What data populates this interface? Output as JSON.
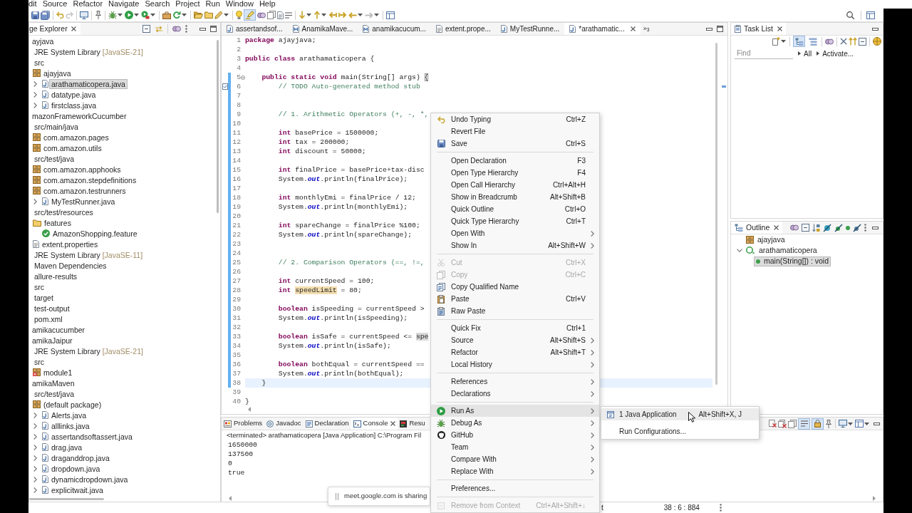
{
  "menu_bar": {
    "items": [
      "dit",
      "Source",
      "Refactor",
      "Navigate",
      "Search",
      "Project",
      "Run",
      "Window",
      "Help"
    ]
  },
  "main_toolbar": {
    "toggles": [
      {
        "pressed": true
      }
    ]
  },
  "package_explorer": {
    "title": "ge Explorer",
    "tree": [
      {
        "label": "ayjava",
        "selected": false,
        "children": [
          {
            "label": "JRE System Library",
            "decoration": "[JavaSE-21]",
            "selected": false
          },
          {
            "label": "src",
            "selected": false,
            "children": [
              {
                "label": "ajayjava",
                "kind": "package",
                "selected": false,
                "children": [
                  {
                    "label": "arathamaticopera.java",
                    "kind": "java",
                    "expanded": false,
                    "selected": true
                  },
                  {
                    "label": "datatype.java",
                    "kind": "java",
                    "expanded": false,
                    "selected": false
                  },
                  {
                    "label": "firstclass.java",
                    "kind": "java",
                    "expanded": false,
                    "selected": false
                  }
                ]
              }
            ]
          }
        ]
      },
      {
        "label": "mazonFrameworkCucumber",
        "selected": false,
        "children": [
          {
            "label": "src/main/java",
            "selected": false,
            "children": [
              {
                "label": "com.amazon.pages",
                "kind": "package",
                "selected": false
              },
              {
                "label": "com.amazon.utils",
                "kind": "package",
                "selected": false
              }
            ]
          },
          {
            "label": "src/test/java",
            "selected": false,
            "children": [
              {
                "label": "com.amazon.apphooks",
                "kind": "package",
                "selected": false
              },
              {
                "label": "com.amazon.stepdefinitions",
                "kind": "package",
                "selected": false
              },
              {
                "label": "com.amazon.testrunners",
                "kind": "package",
                "selected": false,
                "children": [
                  {
                    "label": "MyTestRunner.java",
                    "kind": "java",
                    "expanded": false,
                    "selected": false
                  }
                ]
              }
            ]
          },
          {
            "label": "src/test/resources",
            "selected": false,
            "children": [
              {
                "label": "features",
                "kind": "folder",
                "selected": false,
                "children": [
                  {
                    "label": "AmazonShopping.feature",
                    "kind": "feature",
                    "selected": false
                  }
                ]
              },
              {
                "label": "extent.properties",
                "kind": "file",
                "selected": false
              }
            ]
          },
          {
            "label": "JRE System Library",
            "decoration": "[JavaSE-11]",
            "selected": false
          },
          {
            "label": "Maven Dependencies",
            "selected": false
          },
          {
            "label": "allure-results",
            "selected": false
          },
          {
            "label": "src",
            "selected": false
          },
          {
            "label": "target",
            "selected": false
          },
          {
            "label": "test-output",
            "selected": false
          },
          {
            "label": "pom.xml",
            "selected": false
          }
        ]
      },
      {
        "label": "amikacucumber",
        "selected": false
      },
      {
        "label": "amikaJaipur",
        "selected": false,
        "children": [
          {
            "label": "JRE System Library",
            "decoration": "[JavaSE-21]",
            "selected": false
          },
          {
            "label": "src",
            "selected": false,
            "children": [
              {
                "label": "module1",
                "kind": "package_error",
                "selected": false
              }
            ]
          }
        ]
      },
      {
        "label": "amikaMaven",
        "selected": false,
        "children": [
          {
            "label": "src/test/java",
            "selected": false,
            "children": [
              {
                "label": "(default package)",
                "kind": "package",
                "selected": false,
                "children": [
                  {
                    "label": "Alerts.java",
                    "kind": "java",
                    "expanded": false,
                    "selected": false
                  },
                  {
                    "label": "alllinks.java",
                    "kind": "java",
                    "expanded": false,
                    "selected": false
                  },
                  {
                    "label": "assertandsoftassert.java",
                    "kind": "java",
                    "expanded": false,
                    "selected": false
                  },
                  {
                    "label": "drag.java",
                    "kind": "java",
                    "expanded": false,
                    "selected": false
                  },
                  {
                    "label": "draganddrop.java",
                    "kind": "java",
                    "expanded": false,
                    "selected": false
                  },
                  {
                    "label": "dropdown.java",
                    "kind": "java",
                    "expanded": false,
                    "selected": false
                  },
                  {
                    "label": "dynamicdropdown.java",
                    "kind": "java",
                    "expanded": false,
                    "selected": false
                  },
                  {
                    "label": "explicitwait.java",
                    "kind": "java",
                    "expanded": false,
                    "selected": false
                  }
                ]
              }
            ]
          }
        ]
      }
    ]
  },
  "editor": {
    "tabs": [
      {
        "label": "assertandsof...",
        "kind": "java",
        "selected": false
      },
      {
        "label": "AnamikaMave...",
        "kind": "maven",
        "selected": false
      },
      {
        "label": "anamikacucum...",
        "kind": "maven",
        "selected": false
      },
      {
        "label": "extent.prope...",
        "kind": "properties",
        "selected": false
      },
      {
        "label": "MyTestRunne...",
        "kind": "java",
        "selected": false
      },
      {
        "label": "*arathamatic...",
        "kind": "java",
        "selected": true
      }
    ],
    "overflow": "»$_{3}$",
    "lines": [
      {
        "number": "1",
        "segments": [
          {
            "kind": "keyword",
            "text": "package"
          },
          {
            "kind": "text",
            "text": " ajayjava;"
          }
        ]
      },
      {
        "number": "2"
      },
      {
        "number": "3",
        "segments": [
          {
            "kind": "keyword",
            "text": "public class"
          },
          {
            "kind": "text",
            "text": " arathamaticopera {"
          }
        ],
        "children": [
          {
            "number": "4"
          },
          {
            "number": "5",
            "in_range": true,
            "expanded": true,
            "segments": [
              {
                "kind": "keyword",
                "text": "public static void"
              },
              {
                "kind": "text",
                "text": " main(String[] args) "
              },
              {
                "kind": "bracket_match",
                "text": "{"
              }
            ],
            "children": [
              {
                "number": "6",
                "in_range": true,
                "task": true,
                "segments": [
                  {
                    "kind": "comment",
                    "text": "// TODO Auto-generated method stub"
                  }
                ]
              },
              {
                "number": "7",
                "in_range": true
              },
              {
                "number": "8",
                "in_range": true
              },
              {
                "number": "9",
                "in_range": true,
                "segments": [
                  {
                    "kind": "comment",
                    "text": "// 1. Arithmetic Operators (+, -, *,"
                  }
                ]
              },
              {
                "number": "10",
                "in_range": true
              },
              {
                "number": "11",
                "in_range": true,
                "segments": [
                  {
                    "kind": "keyword",
                    "text": "int"
                  },
                  {
                    "kind": "text",
                    "text": " basePrice = 1500000;"
                  }
                ]
              },
              {
                "number": "12",
                "in_range": true,
                "segments": [
                  {
                    "kind": "keyword",
                    "text": "int"
                  },
                  {
                    "kind": "text",
                    "text": " tax = 200000;"
                  }
                ]
              },
              {
                "number": "13",
                "in_range": true,
                "segments": [
                  {
                    "kind": "keyword",
                    "text": "int"
                  },
                  {
                    "kind": "text",
                    "text": " discount = 50000;"
                  }
                ]
              },
              {
                "number": "14",
                "in_range": true
              },
              {
                "number": "15",
                "in_range": true,
                "segments": [
                  {
                    "kind": "keyword",
                    "text": "int"
                  },
                  {
                    "kind": "text",
                    "text": " finalPrice = basePrice+tax-disc"
                  }
                ]
              },
              {
                "number": "16",
                "in_range": true,
                "segments": [
                  {
                    "kind": "text",
                    "text": "System."
                  },
                  {
                    "kind": "field",
                    "text": "out"
                  },
                  {
                    "kind": "text",
                    "text": ".println(finalPrice);"
                  }
                ]
              },
              {
                "number": "17",
                "in_range": true
              },
              {
                "number": "18",
                "in_range": true,
                "segments": [
                  {
                    "kind": "keyword",
                    "text": "int"
                  },
                  {
                    "kind": "text",
                    "text": " monthlyEmi = finalPrice / 12;"
                  }
                ]
              },
              {
                "number": "19",
                "in_range": true,
                "segments": [
                  {
                    "kind": "text",
                    "text": "System."
                  },
                  {
                    "kind": "field",
                    "text": "out"
                  },
                  {
                    "kind": "text",
                    "text": ".println(monthlyEmi);"
                  }
                ]
              },
              {
                "number": "20",
                "in_range": true
              },
              {
                "number": "21",
                "in_range": true,
                "segments": [
                  {
                    "kind": "keyword",
                    "text": "int"
                  },
                  {
                    "kind": "text",
                    "text": " spareChange = finalPrice %100;"
                  }
                ]
              },
              {
                "number": "22",
                "in_range": true,
                "segments": [
                  {
                    "kind": "text",
                    "text": "System."
                  },
                  {
                    "kind": "field",
                    "text": "out"
                  },
                  {
                    "kind": "text",
                    "text": ".println(spareChange);"
                  }
                ]
              },
              {
                "number": "23",
                "in_range": true
              },
              {
                "number": "24",
                "in_range": true
              },
              {
                "number": "25",
                "in_range": true,
                "segments": [
                  {
                    "kind": "comment",
                    "text": "// 2. Comparison Operators (==, !=,"
                  }
                ]
              },
              {
                "number": "26",
                "in_range": true
              },
              {
                "number": "27",
                "in_range": true,
                "segments": [
                  {
                    "kind": "keyword",
                    "text": "int"
                  },
                  {
                    "kind": "text",
                    "text": " currentSpeed = 100;"
                  }
                ]
              },
              {
                "number": "28",
                "in_range": true,
                "segments": [
                  {
                    "kind": "keyword",
                    "text": "int "
                  },
                  {
                    "kind": "write_occurrence",
                    "text": "speedLimit"
                  },
                  {
                    "kind": "text",
                    "text": " = 80;"
                  }
                ]
              },
              {
                "number": "29",
                "in_range": true
              },
              {
                "number": "30",
                "in_range": true,
                "segments": [
                  {
                    "kind": "keyword",
                    "text": "boolean"
                  },
                  {
                    "kind": "text",
                    "text": " isSpeeding = currentSpeed >"
                  }
                ]
              },
              {
                "number": "31",
                "in_range": true,
                "segments": [
                  {
                    "kind": "text",
                    "text": "System."
                  },
                  {
                    "kind": "field",
                    "text": "out"
                  },
                  {
                    "kind": "text",
                    "text": ".println(isSpeeding);"
                  }
                ]
              },
              {
                "number": "32",
                "in_range": true
              },
              {
                "number": "33",
                "in_range": true,
                "segments": [
                  {
                    "kind": "keyword",
                    "text": "boolean"
                  },
                  {
                    "kind": "text",
                    "text": " isSafe = currentSpeed <= "
                  },
                  {
                    "kind": "read_occurrence",
                    "text": "spe"
                  }
                ]
              },
              {
                "number": "34",
                "in_range": true,
                "segments": [
                  {
                    "kind": "text",
                    "text": "System."
                  },
                  {
                    "kind": "field",
                    "text": "out"
                  },
                  {
                    "kind": "text",
                    "text": ".println(isSafe);"
                  }
                ]
              },
              {
                "number": "35",
                "in_range": true
              },
              {
                "number": "36",
                "in_range": true,
                "segments": [
                  {
                    "kind": "keyword",
                    "text": "boolean"
                  },
                  {
                    "kind": "text",
                    "text": " bothEqual = currentSpeed =="
                  }
                ]
              },
              {
                "number": "37",
                "in_range": true,
                "segments": [
                  {
                    "kind": "text",
                    "text": "System."
                  },
                  {
                    "kind": "field",
                    "text": "out"
                  },
                  {
                    "kind": "text",
                    "text": ".println(bothEqual);"
                  }
                ]
              }
            ]
          },
          {
            "number": "38",
            "in_range": true,
            "current": true,
            "segments": [
              {
                "kind": "text",
                "text": "}"
              }
            ]
          },
          {
            "number": "39"
          }
        ]
      },
      {
        "number": "40",
        "segments": [
          {
            "kind": "text",
            "text": "}"
          }
        ]
      }
    ]
  },
  "task_list": {
    "title": "Task List",
    "toggles": [
      {
        "pressed": true
      },
      {
        "pressed": false
      }
    ],
    "find": {
      "placeholder": "Find"
    },
    "filters": [
      "All",
      "Activate..."
    ]
  },
  "outline": {
    "title": "Outline",
    "tree": [
      {
        "label": "ajayjava",
        "kind": "package",
        "selected": false
      },
      {
        "label": "arathamaticopera",
        "kind": "class",
        "expanded": true,
        "selected": false,
        "children": [
          {
            "label": "main(String[]) : void",
            "kind": "method",
            "selected": true
          }
        ]
      }
    ]
  },
  "console": {
    "tabs": [
      {
        "label": "Problems",
        "kind": "problems",
        "selected": false
      },
      {
        "label": "Javadoc",
        "kind": "javadoc",
        "selected": false
      },
      {
        "label": "Declaration",
        "kind": "declaration",
        "selected": false
      },
      {
        "label": "Console",
        "kind": "console",
        "selected": true
      },
      {
        "label": "Resu",
        "kind": "results",
        "selected": false
      }
    ],
    "toggles": [
      {
        "pressed": true
      },
      {
        "pressed": true
      }
    ],
    "header": "<terminated> arathamaticopera [Java Application] C:\\Program Fil",
    "output": [
      "1650000",
      "137500",
      "0",
      "true"
    ]
  },
  "status_bar": {
    "field_1": "t",
    "position": "38 : 6 : 884"
  },
  "share_notice": {
    "text": "meet.google.com is sharing"
  },
  "context_menu": {
    "groups": [
      [
        {
          "label": "Undo Typing",
          "shortcut": "Ctrl+Z",
          "kind": "undo",
          "submenu": false,
          "disabled": false,
          "selected": false
        },
        {
          "label": "Revert File",
          "submenu": false,
          "disabled": false,
          "selected": false
        },
        {
          "label": "Save",
          "shortcut": "Ctrl+S",
          "kind": "save",
          "submenu": false,
          "disabled": false,
          "selected": false
        }
      ],
      [
        {
          "label": "Open Declaration",
          "shortcut": "F3",
          "submenu": false,
          "disabled": false,
          "selected": false
        },
        {
          "label": "Open Type Hierarchy",
          "shortcut": "F4",
          "submenu": false,
          "disabled": false,
          "selected": false
        },
        {
          "label": "Open Call Hierarchy",
          "shortcut": "Ctrl+Alt+H",
          "submenu": false,
          "disabled": false,
          "selected": false
        },
        {
          "label": "Show in Breadcrumb",
          "shortcut": "Alt+Shift+B",
          "submenu": false,
          "disabled": false,
          "selected": false
        },
        {
          "label": "Quick Outline",
          "shortcut": "Ctrl+O",
          "submenu": false,
          "disabled": false,
          "selected": false
        },
        {
          "label": "Quick Type Hierarchy",
          "shortcut": "Ctrl+T",
          "submenu": false,
          "disabled": false,
          "selected": false
        },
        {
          "label": "Open With",
          "submenu": true,
          "disabled": false,
          "selected": false
        },
        {
          "label": "Show In",
          "shortcut": "Alt+Shift+W",
          "submenu": true,
          "disabled": false,
          "selected": false
        }
      ],
      [
        {
          "label": "Cut",
          "shortcut": "Ctrl+X",
          "kind": "cut",
          "submenu": false,
          "disabled": true,
          "selected": false
        },
        {
          "label": "Copy",
          "shortcut": "Ctrl+C",
          "kind": "copy",
          "submenu": false,
          "disabled": true,
          "selected": false
        },
        {
          "label": "Copy Qualified Name",
          "kind": "copy_name",
          "submenu": false,
          "disabled": false,
          "selected": false
        },
        {
          "label": "Paste",
          "shortcut": "Ctrl+V",
          "kind": "paste",
          "submenu": false,
          "disabled": false,
          "selected": false
        },
        {
          "label": "Raw Paste",
          "kind": "raw_paste",
          "submenu": false,
          "disabled": false,
          "selected": false
        }
      ],
      [
        {
          "label": "Quick Fix",
          "shortcut": "Ctrl+1",
          "submenu": false,
          "disabled": false,
          "selected": false
        },
        {
          "label": "Source",
          "shortcut": "Alt+Shift+S",
          "submenu": true,
          "disabled": false,
          "selected": false
        },
        {
          "label": "Refactor",
          "shortcut": "Alt+Shift+T",
          "submenu": true,
          "disabled": false,
          "selected": false
        },
        {
          "label": "Local History",
          "submenu": true,
          "disabled": false,
          "selected": false
        }
      ],
      [
        {
          "label": "References",
          "submenu": true,
          "disabled": false,
          "selected": false
        },
        {
          "label": "Declarations",
          "submenu": true,
          "disabled": false,
          "selected": false
        }
      ],
      [
        {
          "label": "Run As",
          "kind": "run",
          "submenu": true,
          "disabled": false,
          "selected": true,
          "children": [
            {
              "label": "1 Java Application",
              "shortcut": "Alt+Shift+X, J",
              "kind": "java_app",
              "selected": true
            },
            {
              "label": "Run Configurations...",
              "selected": false
            }
          ]
        },
        {
          "label": "Debug As",
          "kind": "debug",
          "submenu": true,
          "disabled": false,
          "selected": false
        },
        {
          "label": "GitHub",
          "kind": "github",
          "submenu": true,
          "disabled": false,
          "selected": false
        },
        {
          "label": "Team",
          "submenu": true,
          "disabled": false,
          "selected": false
        },
        {
          "label": "Compare With",
          "submenu": true,
          "disabled": false,
          "selected": false
        },
        {
          "label": "Replace With",
          "submenu": true,
          "disabled": false,
          "selected": false
        }
      ],
      [
        {
          "label": "Preferences...",
          "submenu": false,
          "disabled": false,
          "selected": false
        }
      ],
      [
        {
          "label": "Remove from Context",
          "shortcut": "Ctrl+Alt+Shift+↓",
          "kind": "remove",
          "submenu": false,
          "disabled": true,
          "selected": false
        }
      ]
    ]
  }
}
